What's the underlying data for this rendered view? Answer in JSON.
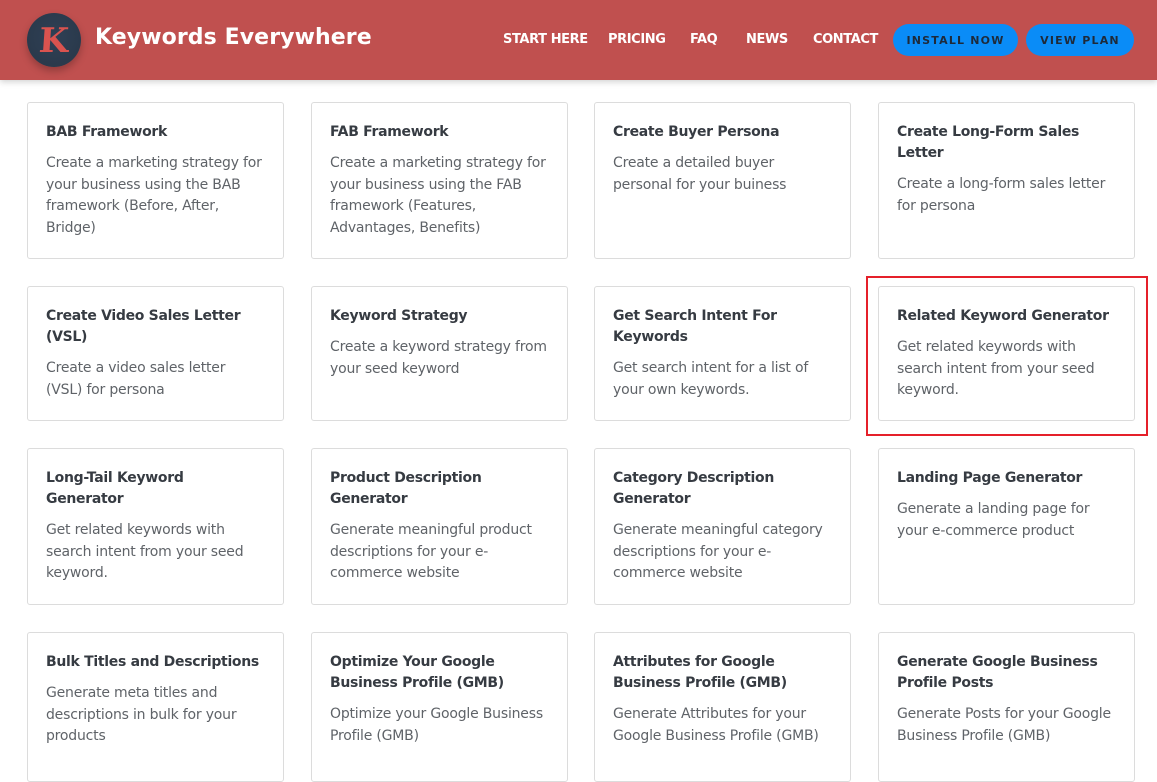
{
  "header": {
    "logo_letter": "K",
    "brand": "Keywords Everywhere",
    "nav": [
      {
        "label": "START HERE"
      },
      {
        "label": "PRICING"
      },
      {
        "label": "FAQ"
      },
      {
        "label": "NEWS"
      },
      {
        "label": "CONTACT"
      }
    ],
    "install_label": "INSTALL NOW",
    "plan_label": "VIEW PLAN"
  },
  "colors": {
    "header_bg": "#c0504f",
    "button_bg": "#0a8cf7",
    "highlight": "#e5202a"
  },
  "cards": [
    {
      "title": "BAB Framework",
      "desc": "Create a marketing strategy for your business using the BAB framework (Before, After, Bridge)"
    },
    {
      "title": "FAB Framework",
      "desc": "Create a marketing strategy for your business using the FAB framework (Features, Advantages, Benefits)"
    },
    {
      "title": "Create Buyer Persona",
      "desc": "Create a detailed buyer personal for your buiness"
    },
    {
      "title": "Create Long-Form Sales Letter",
      "desc": "Create a long-form sales letter for persona"
    },
    {
      "title": "Create Video Sales Letter (VSL)",
      "desc": "Create a video sales letter (VSL) for persona"
    },
    {
      "title": "Keyword Strategy",
      "desc": "Create a keyword strategy from your seed keyword"
    },
    {
      "title": "Get Search Intent For Keywords",
      "desc": "Get search intent for a list of your own keywords."
    },
    {
      "title": "Related Keyword Generator",
      "desc": "Get related keywords with search intent from your seed keyword.",
      "highlighted": true
    },
    {
      "title": "Long-Tail Keyword Generator",
      "desc": "Get related keywords with search intent from your seed keyword."
    },
    {
      "title": "Product Description Generator",
      "desc": "Generate meaningful product descriptions for your e-commerce website"
    },
    {
      "title": "Category Description Generator",
      "desc": "Generate meaningful category descriptions for your e-commerce website"
    },
    {
      "title": "Landing Page Generator",
      "desc": "Generate a landing page for your e-commerce product"
    },
    {
      "title": "Bulk Titles and Descriptions",
      "desc": "Generate meta titles and descriptions in bulk for your products"
    },
    {
      "title": "Optimize Your Google Business Profile (GMB)",
      "desc": "Optimize your Google Business Profile (GMB)"
    },
    {
      "title": "Attributes for Google Business Profile (GMB)",
      "desc": "Generate Attributes for your Google Business Profile (GMB)"
    },
    {
      "title": "Generate Google Business Profile Posts",
      "desc": "Generate Posts for your Google Business Profile (GMB)"
    }
  ]
}
